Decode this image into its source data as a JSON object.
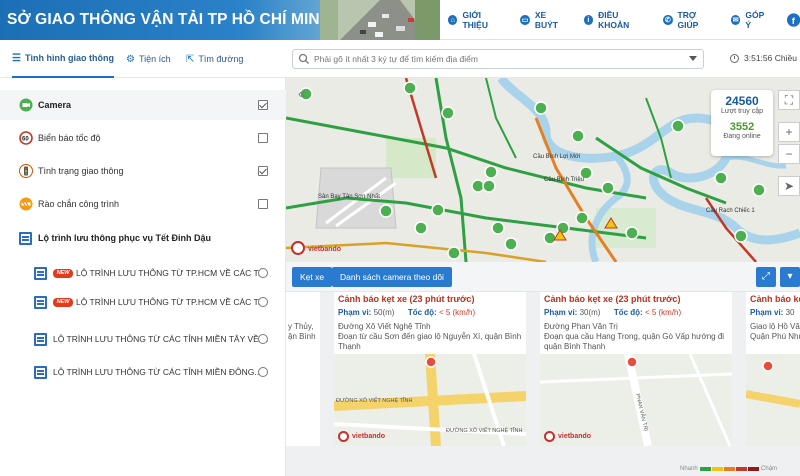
{
  "header": {
    "title": "SỞ GIAO THÔNG VẬN TẢI TP HỒ CHÍ MINH",
    "nav": [
      {
        "label": "GIỚI THIỆU",
        "icon": "home-icon"
      },
      {
        "label": "XE BUÝT",
        "icon": "bus-icon"
      },
      {
        "label": "ĐIỀU KHOẢN",
        "icon": "info-icon"
      },
      {
        "label": "TRỢ GIÚP",
        "icon": "phone-icon"
      },
      {
        "label": "GÓP Ý",
        "icon": "mail-icon"
      }
    ]
  },
  "tabs": [
    {
      "label": "Tình hình giao thông",
      "icon": "layers-icon",
      "active": true
    },
    {
      "label": "Tiện ích",
      "icon": "gear-icon",
      "active": false
    },
    {
      "label": "Tìm đường",
      "icon": "directions-icon",
      "active": false
    }
  ],
  "search": {
    "placeholder": "Phải gõ ít nhất 3 ký tự để tìm kiếm địa điểm"
  },
  "clock": "3:51:56 Chiều",
  "layers": [
    {
      "label": "Camera",
      "icon": "camera-icon",
      "checked": true,
      "selected": true
    },
    {
      "label": "Biển báo tốc độ",
      "icon": "speed-sign-icon",
      "checked": false
    },
    {
      "label": "Tình trạng giao thông",
      "icon": "traffic-light-icon",
      "checked": true
    },
    {
      "label": "Rào chắn công trình",
      "icon": "barrier-icon",
      "checked": false
    }
  ],
  "routes_header": "Lộ trình lưu thông phục vụ Tết Đinh Dậu",
  "routes": [
    {
      "label": "LỘ TRÌNH LƯU THÔNG TỪ TP.HCM VỀ CÁC T...",
      "is_new": true
    },
    {
      "label": "LỘ TRÌNH LƯU THÔNG TỪ TP.HCM VỀ CÁC T...",
      "is_new": true
    },
    {
      "label": "LỘ TRÌNH LƯU THÔNG TỪ CÁC TỈNH MIỀN TÂY VỀ ...",
      "is_new": false
    },
    {
      "label": "LỘ TRÌNH LƯU THÔNG TỪ CÁC TỈNH MIỀN ĐÔNG...",
      "is_new": false
    }
  ],
  "new_badge": "NEW",
  "map": {
    "labels": [
      "Cầu Bình Lợi Mới",
      "Cầu Bình Triệu",
      "Cầu Rạch Chiếc 1",
      "Sân Bay Tân Sơn Nhất"
    ],
    "visits": "24560",
    "visits_label": "Lượt truy cập",
    "online": "3552",
    "online_label": "Đang online",
    "brand": "vietbando"
  },
  "buttons": {
    "left": "Kẹt xe",
    "list": "Danh sách camera theo dõi"
  },
  "partial_left": {
    "lines": [
      "y Thủy,",
      "ận Bình"
    ]
  },
  "cards": [
    {
      "title": "Cảnh báo kẹt xe (23 phút trước)",
      "range_label": "Phạm vi:",
      "range": "50(m)",
      "speed_label": "Tốc độ:",
      "speed": "< 5 (km/h)",
      "desc": "Đường Xô Viết Nghệ Tĩnh",
      "desc2": "Đoạn từ cầu Sơn đến giao lộ Nguyễn Xí, quận Bình Thạnh",
      "map_labels": [
        "ĐƯỜNG XÔ VIẾT NGHỆ TĨNH",
        "ĐƯỜNG XÔ VIẾT NGHỆ TĨNH"
      ]
    },
    {
      "title": "Cảnh báo kẹt xe (23 phút trước)",
      "range_label": "Phạm vi:",
      "range": "30(m)",
      "speed_label": "Tốc độ:",
      "speed": "< 5 (km/h)",
      "desc": "Đường Phan Văn Trị",
      "desc2": "Đoạn qua cầu Hang Trong, quận Gò Vấp hướng đi quận Bình Thạnh",
      "map_labels": [
        "PHAN VĂN TRỊ"
      ]
    },
    {
      "title": "Cảnh báo kẹ",
      "range_label": "Phạm vi:",
      "range": "30",
      "desc": "Giao lộ Hồ Vă",
      "desc2": "Quận Phú Nhu"
    }
  ],
  "legend": {
    "left": "Nhanh",
    "right": "Chậm"
  }
}
